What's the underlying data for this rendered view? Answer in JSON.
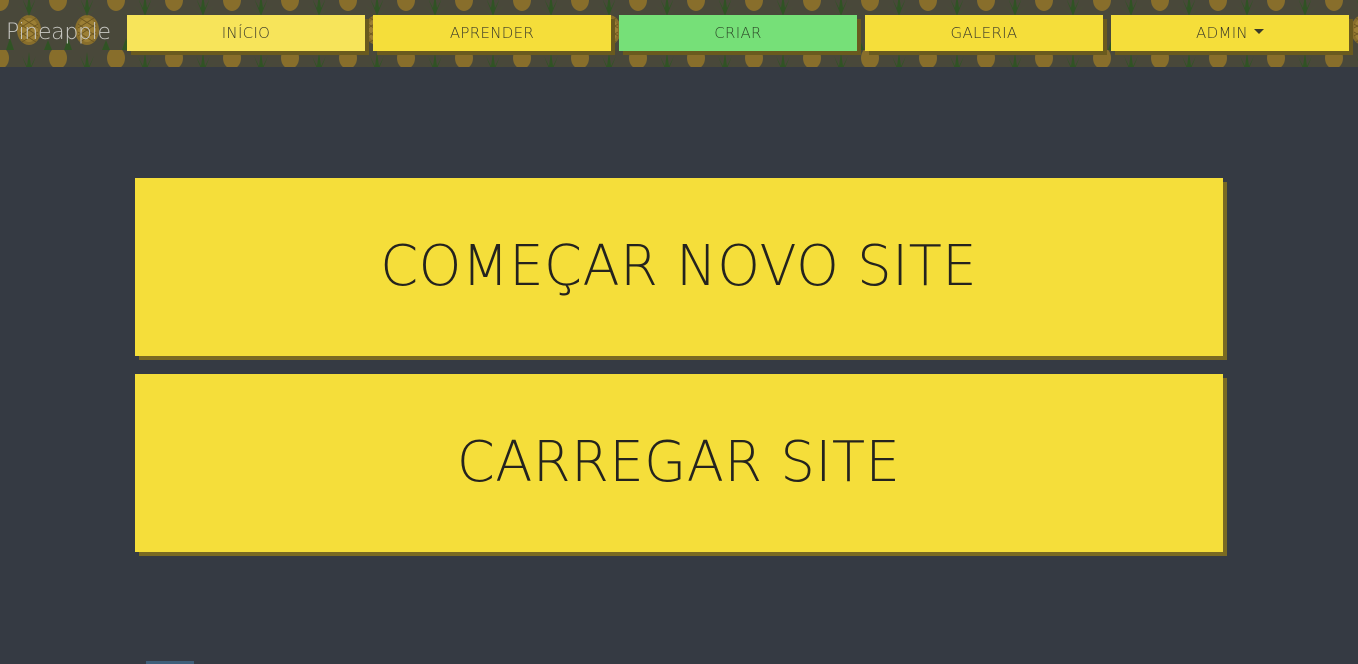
{
  "navbar": {
    "brand": "Pineapple",
    "items": [
      {
        "label": "INÍCIO",
        "state": "hover"
      },
      {
        "label": "APRENDER",
        "state": "default"
      },
      {
        "label": "CRIAR",
        "state": "active"
      },
      {
        "label": "GALERIA",
        "state": "default"
      },
      {
        "label": "ADMIN",
        "state": "default",
        "has_dropdown": true
      }
    ]
  },
  "main": {
    "new_site_label": "COMEÇAR NOVO SITE",
    "load_site_label": "CARREGAR SITE"
  },
  "colors": {
    "page_background": "#353a43",
    "button_yellow": "#f5de3a",
    "active_green": "#76e078",
    "shadow": "#6a5a1e",
    "text_dark": "#24231e"
  }
}
